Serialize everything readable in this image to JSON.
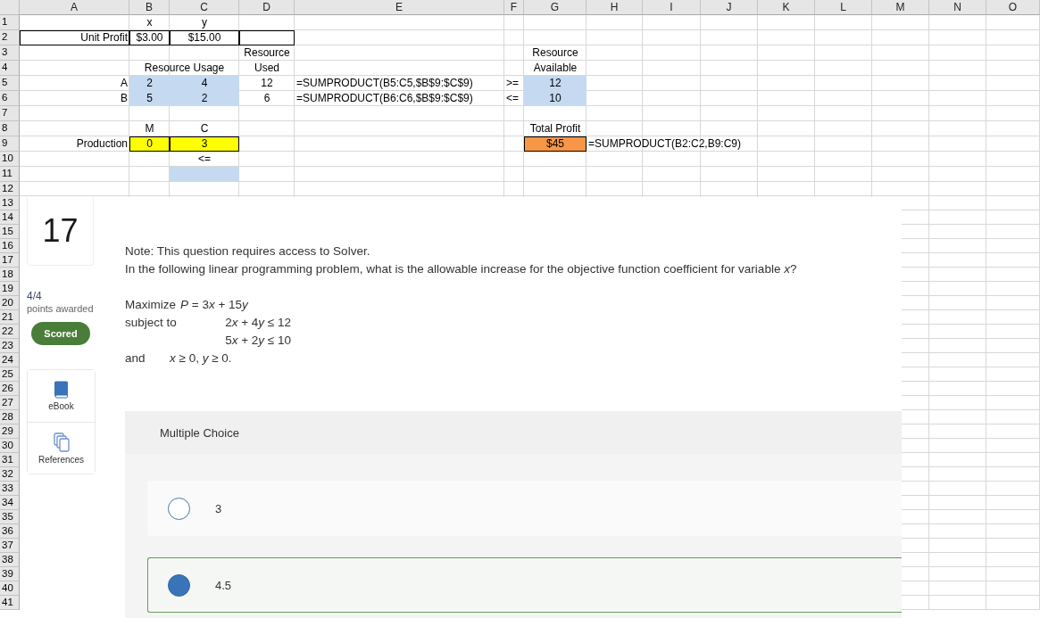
{
  "sheet": {
    "columns": [
      "A",
      "B",
      "C",
      "D",
      "E",
      "F",
      "G",
      "H",
      "I",
      "J",
      "K",
      "L",
      "M",
      "N",
      "O"
    ],
    "rows": [
      {
        "number": "1",
        "cells": [
          {},
          {
            "kind": "value",
            "text": "x"
          },
          {
            "kind": "value",
            "text": "y"
          }
        ]
      },
      {
        "number": "2",
        "cells": [
          {
            "kind": "label",
            "text": "Unit Profit",
            "boxed": true
          },
          {
            "kind": "value",
            "text": "$3.00",
            "boxed": true
          },
          {
            "kind": "value",
            "text": "$15.00",
            "boxed": true
          },
          {
            "boxed": true
          }
        ]
      },
      {
        "number": "3",
        "cells": [
          {},
          {},
          {},
          {
            "kind": "value",
            "text": "Resource"
          },
          {},
          {},
          {
            "kind": "value",
            "text": "Resource"
          }
        ]
      },
      {
        "number": "4",
        "cells": [
          {},
          {
            "kind": "value",
            "text": "Resource Usage",
            "merged": true
          },
          {
            "kind": "value",
            "text": "Used"
          },
          {},
          {},
          {
            "kind": "value",
            "text": "Available"
          }
        ]
      },
      {
        "number": "5",
        "cells": [
          {
            "kind": "label",
            "text": "A"
          },
          {
            "kind": "value",
            "text": "2",
            "color": "#c5d9f1"
          },
          {
            "kind": "value",
            "text": "4",
            "color": "#c5d9f1"
          },
          {
            "kind": "value",
            "text": "12"
          },
          {
            "kind": "formula",
            "text": "=SUMPRODUCT(B5:C5,$B$9:$C$9)"
          },
          {
            "kind": "formula",
            "text": ">="
          },
          {
            "kind": "value",
            "text": "12",
            "color": "#c5d9f1"
          }
        ]
      },
      {
        "number": "6",
        "cells": [
          {
            "kind": "label",
            "text": "B"
          },
          {
            "kind": "value",
            "text": "5",
            "color": "#c5d9f1"
          },
          {
            "kind": "value",
            "text": "2",
            "color": "#c5d9f1"
          },
          {
            "kind": "value",
            "text": "6"
          },
          {
            "kind": "formula",
            "text": "=SUMPRODUCT(B6:C6,$B$9:$C$9)"
          },
          {
            "kind": "formula",
            "text": "<="
          },
          {
            "kind": "value",
            "text": "10",
            "color": "#c5d9f1"
          }
        ]
      },
      {
        "number": "7"
      },
      {
        "number": "8",
        "cells": [
          {},
          {
            "kind": "value",
            "text": "M"
          },
          {
            "kind": "value",
            "text": "C"
          },
          {},
          {},
          {},
          {
            "kind": "value",
            "text": "Total Profit"
          }
        ]
      },
      {
        "number": "9",
        "cells": [
          {
            "kind": "label",
            "text": "Production"
          },
          {
            "kind": "value",
            "text": "0",
            "color": "#ffff00",
            "boxed": true
          },
          {
            "kind": "value",
            "text": "3",
            "color": "#ffff00",
            "boxed": true
          },
          {},
          {},
          {},
          {
            "kind": "value",
            "text": "$45",
            "color": "#f79646",
            "boxed": true
          },
          {
            "kind": "formula",
            "text": "=SUMPRODUCT(B2:C2,B9:C9)"
          }
        ]
      },
      {
        "number": "10",
        "cells": [
          {},
          {},
          {
            "kind": "value",
            "text": "<="
          }
        ]
      },
      {
        "number": "11",
        "cells": [
          {},
          {},
          {
            "color": "#c5d9f1"
          }
        ]
      },
      {
        "number": "12"
      },
      {
        "number": "13"
      },
      {
        "number": "14"
      },
      {
        "number": "15"
      },
      {
        "number": "16"
      },
      {
        "number": "17"
      },
      {
        "number": "18"
      },
      {
        "number": "19"
      },
      {
        "number": "20"
      },
      {
        "number": "21"
      },
      {
        "number": "22"
      },
      {
        "number": "23"
      },
      {
        "number": "24"
      },
      {
        "number": "25"
      },
      {
        "number": "26"
      },
      {
        "number": "27"
      },
      {
        "number": "28"
      },
      {
        "number": "29"
      },
      {
        "number": "30"
      },
      {
        "number": "31"
      },
      {
        "number": "32"
      },
      {
        "number": "33"
      },
      {
        "number": "34"
      },
      {
        "number": "35"
      },
      {
        "number": "36"
      },
      {
        "number": "37"
      },
      {
        "number": "38"
      },
      {
        "number": "39"
      },
      {
        "number": "40"
      },
      {
        "number": "41"
      }
    ]
  },
  "question": {
    "number": "17",
    "score": "4/4",
    "score_caption": "points awarded",
    "status": "Scored",
    "tools": [
      {
        "kind": "book",
        "label": "eBook"
      },
      {
        "kind": "references",
        "label": "References"
      }
    ],
    "note": "Note: This question requires access to Solver.",
    "prompt": "In the following linear programming problem, what is the allowable increase for the objective function coefficient for variable *x*?",
    "problem": [
      {
        "kind": "objective",
        "label": "Maximize",
        "expression": [
          {
            "kind": "variable",
            "text": "P"
          },
          {
            "kind": "symbol",
            "text": " = 3"
          },
          {
            "kind": "variable",
            "text": "x"
          },
          {
            "kind": "symbol",
            "text": " + 15"
          },
          {
            "kind": "variable",
            "text": "y"
          }
        ]
      },
      {
        "kind": "constraint",
        "label": "subject to",
        "expression": [
          {
            "kind": "symbol",
            "text": "2"
          },
          {
            "kind": "variable",
            "text": "x"
          },
          {
            "kind": "symbol",
            "text": " + 4"
          },
          {
            "kind": "variable",
            "text": "y"
          },
          {
            "kind": "symbol",
            "text": " ≤ 12"
          }
        ]
      },
      {
        "kind": "constraint",
        "expression": [
          {
            "kind": "symbol",
            "text": "5"
          },
          {
            "kind": "variable",
            "text": "x"
          },
          {
            "kind": "symbol",
            "text": " + 2"
          },
          {
            "kind": "variable",
            "text": "y"
          },
          {
            "kind": "symbol",
            "text": " ≤ 10"
          }
        ]
      },
      {
        "kind": "bounds",
        "label": "and",
        "expression": [
          {
            "kind": "variable",
            "text": "x"
          },
          {
            "kind": "symbol",
            "text": " ≥ 0, "
          },
          {
            "kind": "variable",
            "text": "y"
          },
          {
            "kind": "symbol",
            "text": " ≥ 0."
          }
        ]
      }
    ],
    "answer_type": "Multiple Choice",
    "choices": [
      {
        "text": "3",
        "selected": false
      },
      {
        "text": "4.5",
        "selected": true
      }
    ]
  }
}
